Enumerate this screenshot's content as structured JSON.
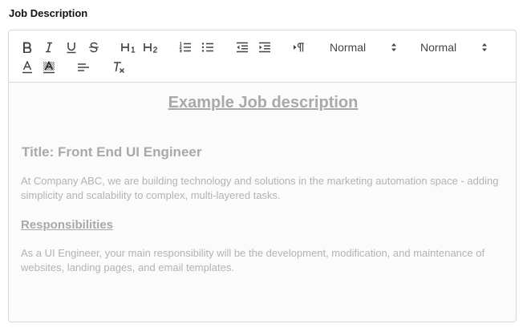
{
  "field": {
    "label": "Job Description"
  },
  "toolbar": {
    "buttons": [
      {
        "name": "bold",
        "glyph": "B"
      },
      {
        "name": "italic",
        "glyph": "I"
      },
      {
        "name": "underline",
        "glyph": "U"
      },
      {
        "name": "strike",
        "glyph": "S"
      },
      {
        "name": "heading-1",
        "glyph": "H1"
      },
      {
        "name": "heading-2",
        "glyph": "H2"
      },
      {
        "name": "ordered-list",
        "glyph": "ol"
      },
      {
        "name": "bullet-list",
        "glyph": "ul"
      },
      {
        "name": "outdent",
        "glyph": "outdent"
      },
      {
        "name": "indent",
        "glyph": "indent"
      },
      {
        "name": "direction-rtl",
        "glyph": "¶"
      },
      {
        "name": "font-color",
        "glyph": "A"
      },
      {
        "name": "background-color",
        "glyph": "A"
      },
      {
        "name": "align",
        "glyph": "align"
      },
      {
        "name": "clear-formatting",
        "glyph": "Tx"
      }
    ],
    "size_select": {
      "value": "Normal"
    },
    "header_select": {
      "value": "Normal"
    }
  },
  "content": {
    "title": "Example Job description",
    "heading": "Title: Front End UI Engineer",
    "intro": "At Company ABC, we are building technology and solutions in the marketing automation space - adding simplicity and scalability to complex, multi-layered tasks.",
    "section_heading": "Responsibilities",
    "responsibilities": "As a UI Engineer, your main responsibility will be the development, modification, and maintenance of websites, landing pages, and email templates."
  },
  "colors": {
    "toolbar_icon": "#444444",
    "placeholder_text": "#b3b3b3",
    "border": "#d8d8d8"
  }
}
